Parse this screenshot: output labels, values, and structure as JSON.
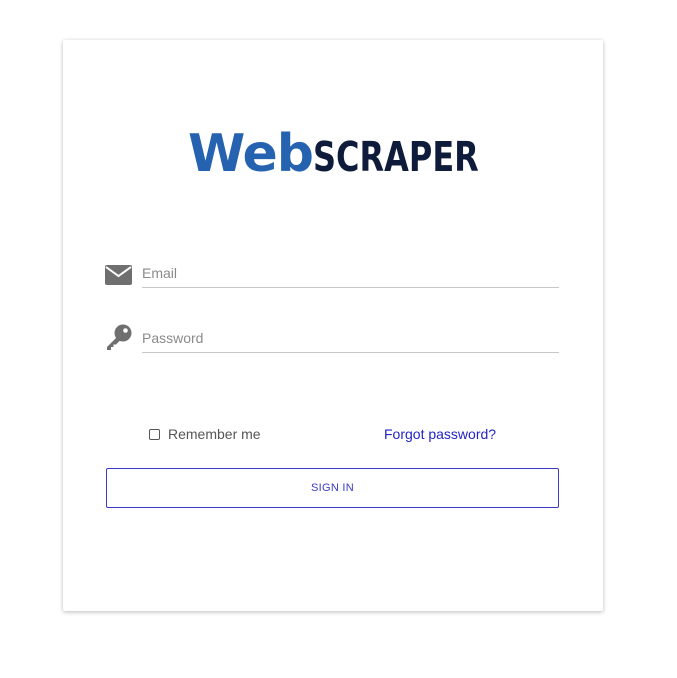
{
  "logo": {
    "part1": "Web",
    "part2": "SCRAPER",
    "color_web": "#2563b0",
    "color_scraper": "#0f1b3a"
  },
  "form": {
    "email": {
      "placeholder": "Email",
      "value": "",
      "icon": "envelope-icon"
    },
    "password": {
      "placeholder": "Password",
      "value": "",
      "icon": "key-icon"
    },
    "remember_label": "Remember me",
    "remember_checked": false,
    "forgot_label": "Forgot password?",
    "signin_label": "SIGN IN"
  },
  "colors": {
    "link": "#2323c8",
    "button_border": "#3a3ac4",
    "icon_gray": "#6f6f6f"
  }
}
